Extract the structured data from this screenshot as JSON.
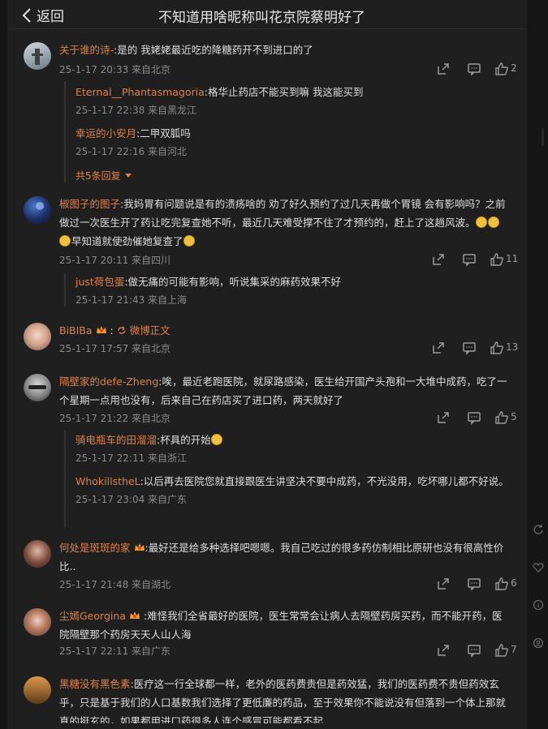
{
  "header": {
    "back_label": "返回",
    "title": "不知道用啥昵称叫花京院蔡明好了"
  },
  "comments": [
    {
      "name": "关于谁的诗-",
      "text": ":是的 我姥姥最近吃的降糖药开不到进口的了",
      "time": "25-1-17 20:33 来自北京",
      "likes": "2",
      "replies": [
        {
          "name": "Eternal__Phantasmagoria",
          "text": ":格华止药店不能买到嘛 我这能买到",
          "time": "25-1-17 22:38 来自黑龙江"
        },
        {
          "name": "幸运的小安月",
          "text": ":二甲双胍吗",
          "time": "25-1-17 22:16 来自河北"
        }
      ],
      "more": "共5条回复"
    },
    {
      "name": "椒图子的图子",
      "text": ":我妈胃有问题说是有的溃疡啥的  劝了好久预约了过几天再做个胃镜  会有影响吗？之前做过一次医生开了药让吃完复查她不听，最近几天难受撑不住了才预约的，赶上了这趟风波。",
      "text_tail": "早知道就使劲催她复查了",
      "time": "25-1-17 20:11 来自四川",
      "likes": "11",
      "replies": [
        {
          "name": "just荷包蛋",
          "text": ":做无痛的可能有影响，听说集采的麻药效果不好",
          "time": "25-1-17 21:43 来自上海"
        }
      ]
    },
    {
      "name": "BiBIBa",
      "text": ":",
      "link": "微博正文",
      "time": "25-1-17 17:57 来自北京",
      "likes": "13"
    },
    {
      "name": "隔壁家的defe-Zheng",
      "text": ":唉，最近老跑医院，就尿路感染，医生给开国产头孢和一大堆中成药，吃了一个星期一点用也没有，后来自己在药店买了进口药，两天就好了",
      "time": "25-1-17 21:22 来自北京",
      "likes": "5",
      "replies": [
        {
          "name": "骑电瓶车的田溜溜",
          "text": ":杯具的开始",
          "time": "25-1-17 22:11 来自浙江"
        },
        {
          "name": "WhokillstheL",
          "text": ":以后再去医院您就直接跟医生讲坚决不要中成药，不光没用，吃坏哪儿都不好说。",
          "time": "25-1-17 23:04 来自广东"
        }
      ]
    },
    {
      "name": "何处是斑斑的家",
      "text": ":最好还是给多种选择吧嗯嗯。我自己吃过的很多药仿制相比原研也没有很高性价比..",
      "time": "25-1-17 21:48 来自湖北",
      "likes": "6"
    },
    {
      "name": "尘嫣Georgina",
      "text": ":难怪我们全省最好的医院，医生常常会让病人去隔壁药房买药，而不能开药，医院隔壁那个药房天天人山人海",
      "time": "25-1-17 22:11 来自广东",
      "likes": "7"
    },
    {
      "name": "黑糖没有黑色素",
      "text": ":医疗这一行全球都一样，老外的医药费贵但是药效猛，我们的医药费不贵但药效玄乎，只是基于我们的人口基数我们选择了更低廉的药品，至于效果你不能说没有但落到一个体上那就真的挺玄的，如果都用进口药很多人连个感冒可能都看不起"
    }
  ],
  "colors": {
    "background": "#1f1f1f",
    "username": "#e0814a",
    "text": "#dedede",
    "meta": "#8a8a8a"
  },
  "icons": [
    "chevron-left-icon",
    "share-icon",
    "comment-icon",
    "thumbs-up-icon",
    "refresh-icon",
    "heart-icon",
    "info-icon",
    "user-icon"
  ]
}
